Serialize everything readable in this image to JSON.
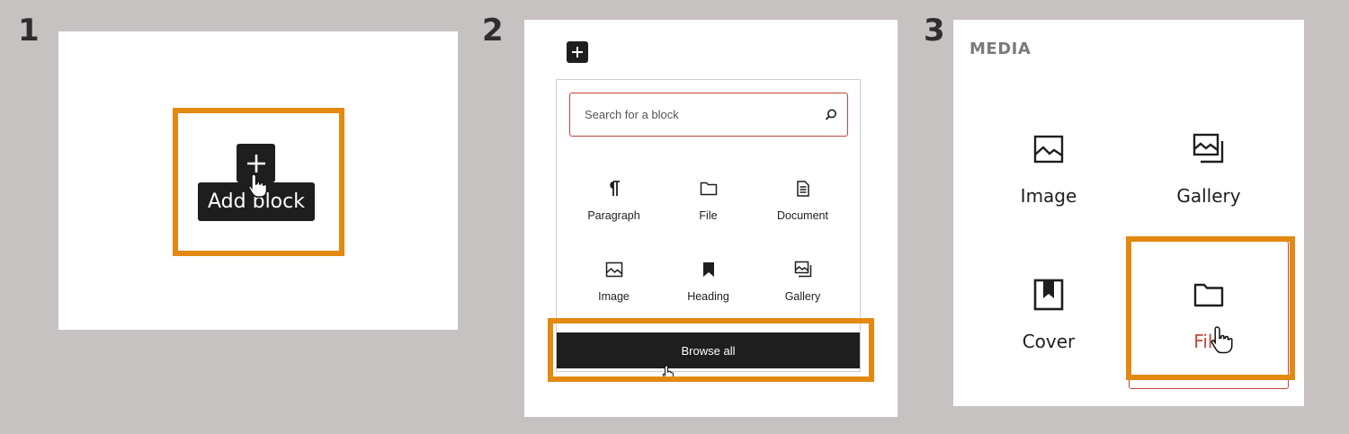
{
  "steps": [
    "1",
    "2",
    "3"
  ],
  "step1": {
    "tooltip": "Add block",
    "plus_icon": "plus-icon"
  },
  "step2": {
    "search": {
      "placeholder": "Search for a block"
    },
    "blocks": [
      {
        "label": "Paragraph",
        "icon": "paragraph-icon"
      },
      {
        "label": "File",
        "icon": "folder-icon"
      },
      {
        "label": "Document",
        "icon": "document-icon"
      },
      {
        "label": "Image",
        "icon": "image-icon"
      },
      {
        "label": "Heading",
        "icon": "bookmark-icon"
      },
      {
        "label": "Gallery",
        "icon": "gallery-icon"
      }
    ],
    "browse_all": "Browse all"
  },
  "step3": {
    "category": "MEDIA",
    "items": [
      {
        "label": "Image",
        "icon": "image-icon"
      },
      {
        "label": "Gallery",
        "icon": "gallery-icon"
      },
      {
        "label": "Cover",
        "icon": "cover-icon"
      },
      {
        "label": "File",
        "icon": "folder-icon"
      }
    ]
  },
  "colors": {
    "background": "#c6c2c1",
    "highlight": "#e3890f",
    "dark": "#1e1e1e",
    "accent_red": "#c2453d"
  }
}
